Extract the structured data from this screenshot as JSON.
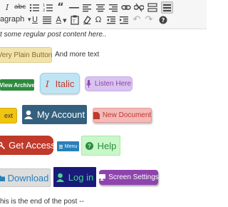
{
  "toolbar": {
    "row1_icons": [
      "italic-icon",
      "strikethrough-icon",
      "bulleted-list-icon",
      "numbered-list-icon",
      "blockquote-icon",
      "horizontal-rule-icon",
      "align-left-icon",
      "align-center-icon",
      "align-right-icon",
      "insert-link-icon",
      "remove-link-icon",
      "read-more-icon",
      "toolbar-toggle-icon"
    ],
    "row2_icons": [
      "underline-icon",
      "justify-icon",
      "text-color-icon",
      "paste-as-text-icon",
      "clear-formatting-icon",
      "special-character-icon",
      "outdent-icon",
      "indent-icon",
      "undo-icon",
      "redo-icon",
      "help-icon"
    ],
    "format_select": "agraph",
    "text_color_glyph": "A",
    "omega_glyph": "Ω"
  },
  "content": {
    "intro_text": "t some regular post content here..",
    "more_text": "And more text",
    "end_text": "his is the end of the post --"
  },
  "buttons": {
    "very_plain": {
      "label": "Very Plain Button",
      "bg": "#f2e3ad",
      "fg": "#8a6d2b"
    },
    "view_archive": {
      "label": "View Archive",
      "bg": "#2e8b3e",
      "fg": "#ffffff"
    },
    "italic": {
      "label": "Italic",
      "bg": "#bfe4f4",
      "fg": "#c0392b",
      "icon": "cursor-icon"
    },
    "listen_here": {
      "label": "Listen Here",
      "bg": "#d9c3ef",
      "fg": "#8e44ad",
      "icon": "microphone-icon"
    },
    "text_partial": {
      "label": "ext",
      "bg": "#f1c40f",
      "fg": "#333333"
    },
    "my_account": {
      "label": "My Account",
      "bg": "#34607e",
      "fg": "#ffffff",
      "icon": "user-icon"
    },
    "new_document": {
      "label": "New Document",
      "bg": "#f4b9b9",
      "fg": "#c0392b",
      "icon": "document-icon"
    },
    "get_access": {
      "label": "Get Access",
      "bg": "#c0392b",
      "fg": "#ffffff",
      "icon": "key-icon"
    },
    "menu": {
      "label": "Menu",
      "bg": "#2980b9",
      "fg": "#ffffff",
      "icon": "menu-icon"
    },
    "help": {
      "label": "Help",
      "bg": "#c9f7c9",
      "fg": "#2e8b3e",
      "icon": "question-circle-icon"
    },
    "download": {
      "label": "Download",
      "bg": "#dddddd",
      "fg": "#2980b9",
      "icon": "folder-icon"
    },
    "log_in": {
      "label": "Log in",
      "bg": "#1a1a7a",
      "fg": "#3ddc84",
      "icon": "user-icon"
    },
    "screen_settings": {
      "label": "Screen Settings",
      "bg": "#8e44ad",
      "fg": "#ffffff",
      "icon": "monitor-icon"
    }
  }
}
